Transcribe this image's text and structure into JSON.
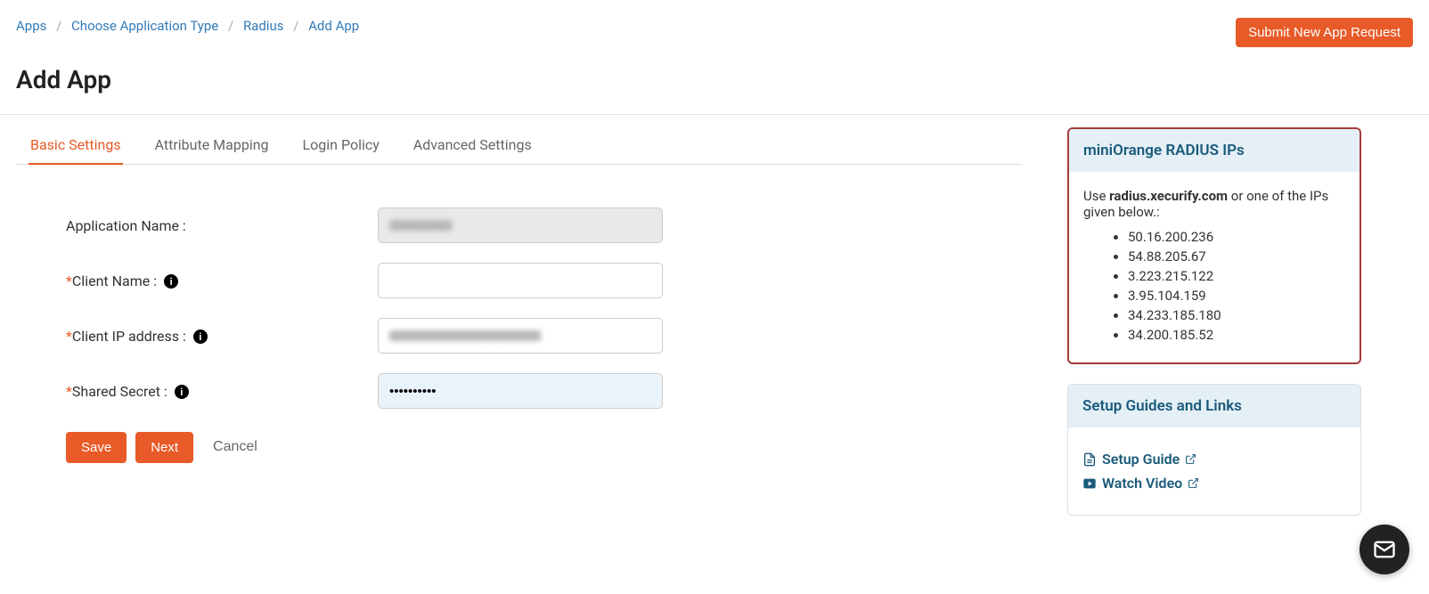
{
  "breadcrumb": {
    "items": [
      "Apps",
      "Choose Application Type",
      "Radius",
      "Add App"
    ]
  },
  "header": {
    "submit_request": "Submit New App Request",
    "page_title": "Add App"
  },
  "tabs": [
    {
      "label": "Basic Settings",
      "active": true
    },
    {
      "label": "Attribute Mapping",
      "active": false
    },
    {
      "label": "Login Policy",
      "active": false
    },
    {
      "label": "Advanced Settings",
      "active": false
    }
  ],
  "form": {
    "app_name_label": "Application Name :",
    "client_name_label": "Client Name :",
    "client_ip_label": "Client IP address :",
    "shared_secret_label": "Shared Secret :",
    "shared_secret_value": "••••••••••",
    "save_label": "Save",
    "next_label": "Next",
    "cancel_label": "Cancel"
  },
  "radius_panel": {
    "title": "miniOrange RADIUS IPs",
    "desc_prefix": "Use ",
    "desc_host": "radius.xecurify.com",
    "desc_suffix": " or one of the IPs given below.:",
    "ips": [
      "50.16.200.236",
      "54.88.205.67",
      "3.223.215.122",
      "3.95.104.159",
      "34.233.185.180",
      "34.200.185.52"
    ]
  },
  "guides_panel": {
    "title": "Setup Guides and Links",
    "setup_guide": "Setup Guide",
    "watch_video": "Watch Video"
  }
}
